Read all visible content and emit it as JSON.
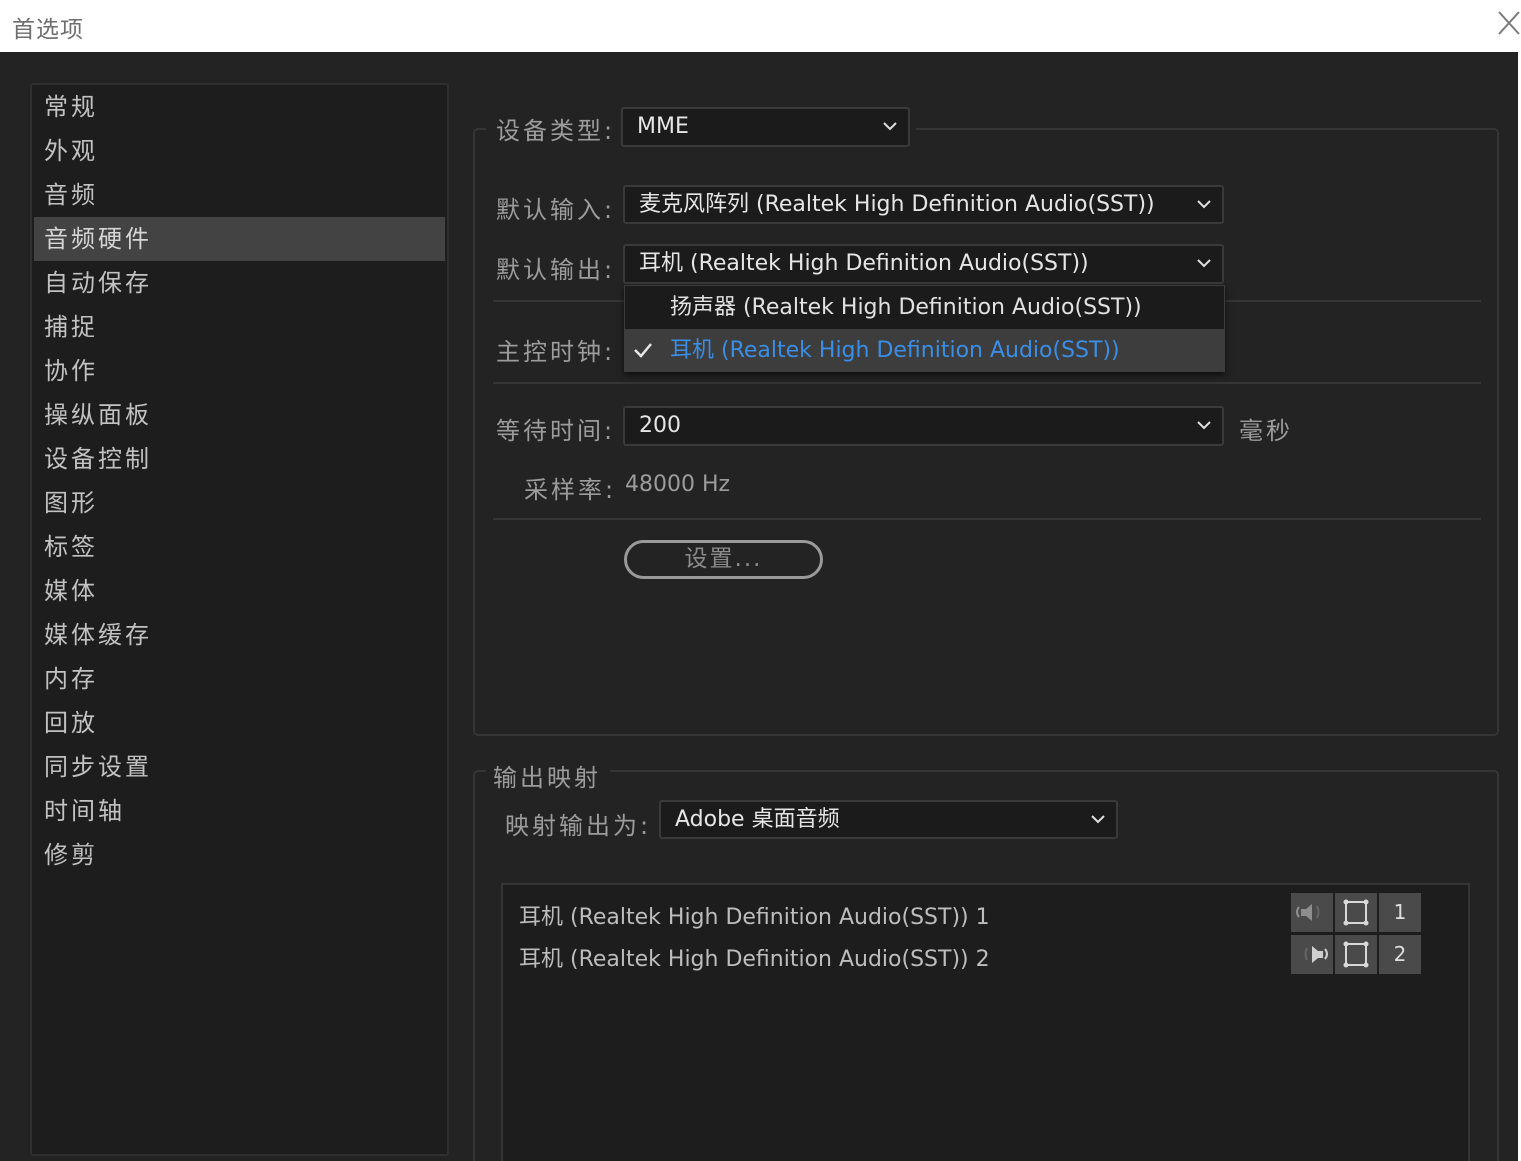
{
  "window": {
    "title": "首选项"
  },
  "sidebar": {
    "items": [
      {
        "label": "常规"
      },
      {
        "label": "外观"
      },
      {
        "label": "音频"
      },
      {
        "label": "音频硬件"
      },
      {
        "label": "自动保存"
      },
      {
        "label": "捕捉"
      },
      {
        "label": "协作"
      },
      {
        "label": "操纵面板"
      },
      {
        "label": "设备控制"
      },
      {
        "label": "图形"
      },
      {
        "label": "标签"
      },
      {
        "label": "媒体"
      },
      {
        "label": "媒体缓存"
      },
      {
        "label": "内存"
      },
      {
        "label": "回放"
      },
      {
        "label": "同步设置"
      },
      {
        "label": "时间轴"
      },
      {
        "label": "修剪"
      }
    ],
    "selected": "音频硬件"
  },
  "device": {
    "type_label": "设备类型:",
    "type_value": "MME",
    "input_label": "默认输入:",
    "input_value": "麦克风阵列 (Realtek High Definition Audio(SST))",
    "output_label": "默认输出:",
    "output_value": "耳机 (Realtek High Definition Audio(SST))",
    "master_clock_label": "主控时钟:",
    "latency_label": "等待时间:",
    "latency_value": "200",
    "latency_unit": "毫秒",
    "sample_rate_label": "采样率:",
    "sample_rate_value": "48000 Hz",
    "settings_button": "设置..."
  },
  "output_popup": {
    "options": [
      {
        "label": "扬声器 (Realtek High Definition Audio(SST))",
        "selected": false
      },
      {
        "label": "耳机 (Realtek High Definition Audio(SST))",
        "selected": true
      }
    ]
  },
  "mapping": {
    "group_title": "输出映射",
    "map_label": "映射输出为:",
    "map_value": "Adobe 桌面音频",
    "rows": [
      {
        "label": "耳机 (Realtek High Definition Audio(SST)) 1",
        "channel": "1",
        "speaker_icon": "left-speaker-icon"
      },
      {
        "label": "耳机 (Realtek High Definition Audio(SST)) 2",
        "channel": "2",
        "speaker_icon": "right-speaker-icon"
      }
    ]
  },
  "colors": {
    "background": "#232323",
    "accent_selected_text": "#3a8ee6",
    "sidebar_selected": "#434343"
  }
}
